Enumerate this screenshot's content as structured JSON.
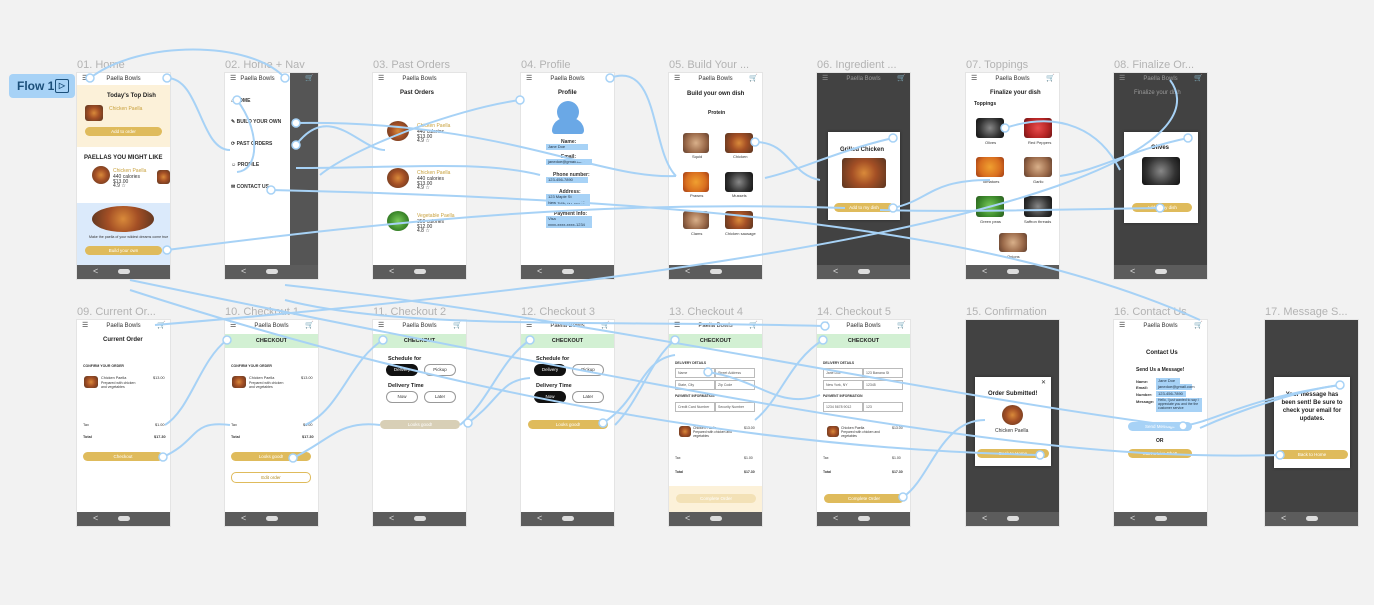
{
  "flow": {
    "label": "Flow 1"
  },
  "frames": [
    {
      "label": "01. Home"
    },
    {
      "label": "02. Home + Nav"
    },
    {
      "label": "03. Past Orders"
    },
    {
      "label": "04. Profile"
    },
    {
      "label": "05. Build Your ..."
    },
    {
      "label": "06. Ingredient ..."
    },
    {
      "label": "07. Toppings"
    },
    {
      "label": "08. Finalize Or..."
    },
    {
      "label": "09. Current Or..."
    },
    {
      "label": "10. Checkout 1"
    },
    {
      "label": "11. Checkout 2"
    },
    {
      "label": "12. Checkout 3"
    },
    {
      "label": "13. Checkout 4"
    },
    {
      "label": "14. Checkout 5"
    },
    {
      "label": "15. Confirmation"
    },
    {
      "label": "16. Contact Us"
    },
    {
      "label": "17. Message S..."
    }
  ],
  "app": {
    "name": "Paella Bowls",
    "back_glyph": "<"
  },
  "home": {
    "top_dish_title": "Today's Top Dish",
    "add_to_order": "Add to order",
    "paellas_heading": "PAELLAS YOU MIGHT LIKE",
    "dish_name": "Chicken Paella",
    "dish_meta": "440 calories",
    "dish_price": "$13.00",
    "dish_rating": "4.9 ☆",
    "promo_text": "Make the paella of your wildest dreams come true",
    "build_button": "Build your own"
  },
  "nav": {
    "items": [
      "HOME",
      "BUILD YOUR OWN",
      "PAST ORDERS",
      "PROFILE",
      "CONTACT US"
    ]
  },
  "past_orders": {
    "title": "Past Orders",
    "items": [
      {
        "name": "Chicken Paella",
        "meta": "440 calories",
        "price": "$13.00",
        "rating": "4.9 ☆"
      },
      {
        "name": "Chicken Paella",
        "meta": "440 calories",
        "price": "$13.00",
        "rating": "4.9 ☆"
      },
      {
        "name": "Vegetable Paella",
        "meta": "350 calories",
        "price": "$12.00",
        "rating": "4.8 ☆"
      }
    ]
  },
  "profile": {
    "title": "Profile",
    "name_label": "Name:",
    "name_value": "Jane Doe",
    "email_label": "Email:",
    "email_value": "janedoe@gmail.com",
    "phone_label": "Phone number:",
    "phone_value": "123-456-7890",
    "address_label": "Address:",
    "address_value": "123 Maple St",
    "address_value2": "New York, NY 12345",
    "payment_label": "Payment Info:",
    "payment_value": "Visa",
    "payment_value2": "xxxx-xxxx-xxxx-1234"
  },
  "build": {
    "title": "Build your own dish",
    "protein_label": "Protein",
    "proteins": [
      "Squid",
      "Chicken",
      "Prawns",
      "Mussels",
      "Clams",
      "Chicken sausage"
    ]
  },
  "ingredient": {
    "modal_title": "Grilled Chicken",
    "add_button": "Add to my dish"
  },
  "toppings": {
    "title": "Finalize your dish",
    "label": "Toppings",
    "items": [
      "Olives",
      "Red Peppers",
      "Tomatoes",
      "Garlic",
      "Green peas",
      "Saffron threads",
      "Onions"
    ]
  },
  "finalize": {
    "title": "Finalize your dish",
    "modal_title": "Olives",
    "add_button": "Add to my dish"
  },
  "current_order": {
    "title": "Current Order",
    "section": "CONFIRM YOUR ORDER",
    "item_name": "Chicken Paella",
    "item_desc": "Prepared with chicken and vegetables",
    "item_price": "$13.00",
    "tax_label": "Tax",
    "tax_value": "$1.00",
    "total_label": "Total",
    "total_value": "$17.30",
    "checkout_button": "Checkout"
  },
  "checkout": {
    "header": "CHECKOUT",
    "confirm_section": "CONFIRM YOUR ORDER",
    "item_name": "Chicken Paella",
    "item_desc": "Prepared with chicken and vegetables",
    "item_price": "$13.00",
    "tax_label": "Tax",
    "tax_value": "$1.00",
    "total_label": "Total",
    "total_value": "$17.30",
    "looks_good": "Looks good!",
    "edit_order": "Edit order",
    "schedule_label": "Schedule for",
    "delivery": "Delivery",
    "pickup": "Pickup",
    "delivery_time": "Delivery Time",
    "now": "Now",
    "later": "Later",
    "delivery_details": "DELIVERY DETAILS",
    "name_ph": "Name",
    "street_ph": "Street Address",
    "state_ph": "State, City",
    "zip_ph": "Zip Code",
    "name_val": "Jane Doe",
    "street_val": "123 Banana St",
    "state_val": "New York, NY",
    "zip_val": "12345",
    "payment_section": "PAYMENT INFORMATION",
    "card_ph": "Credit Card Number",
    "security_ph": "Security Number",
    "card_val": "1234 5678 9012",
    "security_val": "123",
    "complete_order": "Complete Order"
  },
  "confirmation": {
    "close": "✕",
    "title": "Order Submitted!",
    "dish": "Chicken Paella",
    "back_home": "Back to Home"
  },
  "contact": {
    "title": "Contact Us",
    "subtitle": "Send Us a Message!",
    "name_label": "Name:",
    "name_value": "Jane Doe",
    "email_label": "Email:",
    "email_value": "janedoe@gmail.com",
    "number_label": "Number:",
    "number_value": "123-456-7890",
    "message_label": "Message:",
    "message_value": "Hello, I just wanted to say I appreciate you and the the customer service",
    "send_button": "Send Message",
    "or_label": "OR",
    "live_chat": "Start a Live Chat!"
  },
  "message_sent": {
    "text": "Your message has been sent! Be sure to check your email for updates.",
    "back_home": "Back to Home"
  },
  "colors": {
    "accent": "#dfbb5c",
    "wire": "#a7d2f6",
    "checkout_green": "#d2f0d3",
    "field_blue": "#a7d2f6",
    "home_cream": "#fcf1d9",
    "home_blue": "#dbeafb"
  }
}
